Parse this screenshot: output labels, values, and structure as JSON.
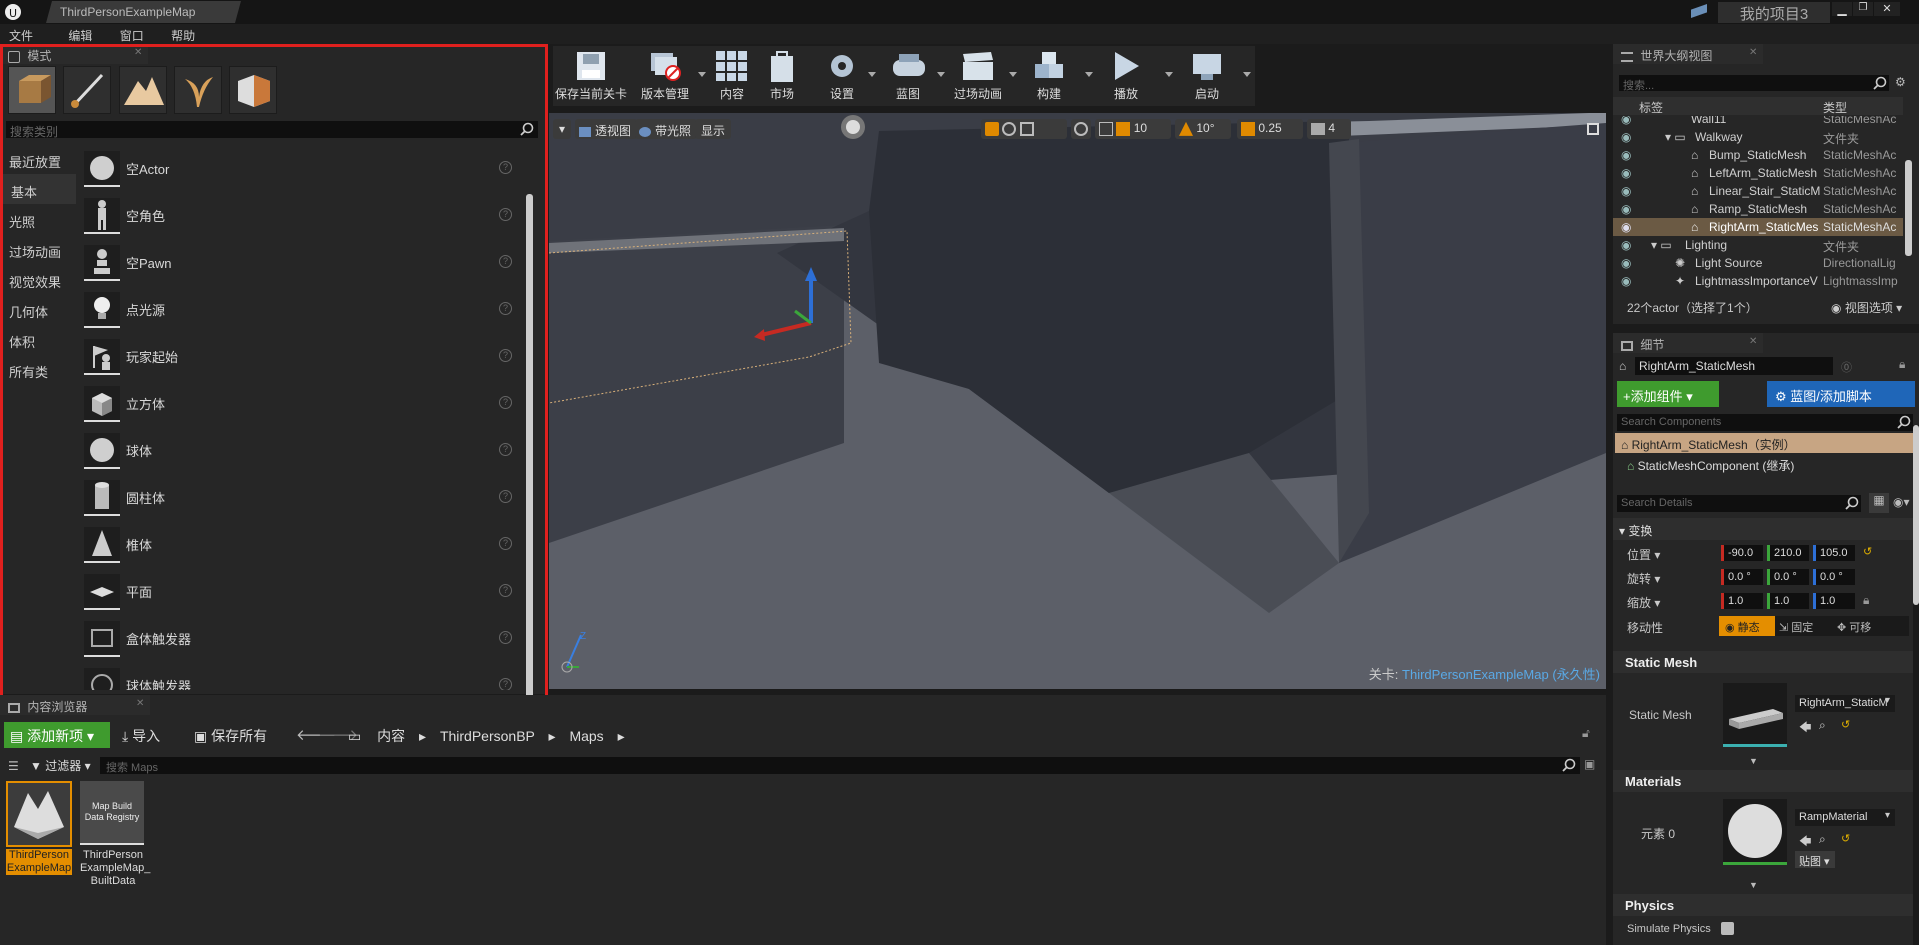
{
  "titlebar": {
    "tab": "ThirdPersonExampleMap",
    "project": "我的项目3"
  },
  "menu": [
    "文件",
    "编辑",
    "窗口",
    "帮助"
  ],
  "modes_panel": {
    "title": "模式",
    "search_placeholder": "搜索类别",
    "categories": [
      "最近放置",
      "基本",
      "光照",
      "过场动画",
      "视觉效果",
      "几何体",
      "体积",
      "所有类"
    ],
    "items": [
      "空Actor",
      "空角色",
      "空Pawn",
      "点光源",
      "玩家起始",
      "立方体",
      "球体",
      "圆柱体",
      "椎体",
      "平面",
      "盒体触发器",
      "球体触发器"
    ]
  },
  "toolbar": {
    "buttons": [
      "保存当前关卡",
      "版本管理",
      "内容",
      "市场",
      "设置",
      "蓝图",
      "过场动画",
      "构建",
      "播放",
      "启动"
    ]
  },
  "viewport": {
    "perspective": "透视图",
    "lit": "带光照",
    "show": "显示",
    "grid_snap": "10",
    "rot_snap": "10°",
    "scale_snap": "0.25",
    "cam_speed": "4",
    "level_label": "关卡:",
    "level_name": "ThirdPersonExampleMap (永久性)",
    "axis_z": "Z"
  },
  "outliner": {
    "title": "世界大纲视图",
    "search_placeholder": "搜索...",
    "col_label": "标签",
    "col_type": "类型",
    "rows": [
      {
        "label": "Wall11",
        "type": "StaticMeshAc"
      },
      {
        "label": "Walkway",
        "type": "文件夹"
      },
      {
        "label": "Bump_StaticMesh",
        "type": "StaticMeshAc"
      },
      {
        "label": "LeftArm_StaticMesh",
        "type": "StaticMeshAc"
      },
      {
        "label": "Linear_Stair_StaticM",
        "type": "StaticMeshAc"
      },
      {
        "label": "Ramp_StaticMesh",
        "type": "StaticMeshAc"
      },
      {
        "label": "RightArm_StaticMes",
        "type": "StaticMeshAc"
      },
      {
        "label": "Lighting",
        "type": "文件夹"
      },
      {
        "label": "Light Source",
        "type": "DirectionalLig"
      },
      {
        "label": "LightmassImportanceV",
        "type": "LightmassImp"
      }
    ],
    "status": "22个actor（选择了1个）",
    "view_options": "视图选项"
  },
  "details": {
    "title": "细节",
    "name_value": "RightArm_StaticMesh",
    "add_component": "+添加组件",
    "blueprint": "蓝图/添加脚本",
    "search_components": "Search Components",
    "instance_row": "RightArm_StaticMesh（实例）",
    "component_row": "StaticMeshComponent (继承)",
    "search_details": "Search Details",
    "transform": "变换",
    "location_label": "位置",
    "location": [
      "-90.0",
      "210.0",
      "105.0"
    ],
    "rotation_label": "旋转",
    "rotation": [
      "0.0 °",
      "0.0 °",
      "0.0 °"
    ],
    "scale_label": "缩放",
    "scale": [
      "1.0",
      "1.0",
      "1.0"
    ],
    "mobility_label": "移动性",
    "mobility": [
      "静态",
      "固定",
      "可移"
    ],
    "static_mesh_section": "Static Mesh",
    "static_mesh_label": "Static Mesh",
    "static_mesh_value": "RightArm_StaticM",
    "materials_section": "Materials",
    "element_label": "元素 0",
    "material_value": "RampMaterial",
    "texture_btn": "贴图",
    "physics_section": "Physics",
    "simulate_label": "Simulate Physics"
  },
  "content_browser": {
    "title": "内容浏览器",
    "add_new": "添加新项",
    "import": "导入",
    "save_all": "保存所有",
    "path": [
      "内容",
      "ThirdPersonBP",
      "Maps"
    ],
    "filter": "过滤器",
    "search_placeholder": "搜索 Maps",
    "assets": [
      {
        "name": "ThirdPerson ExampleMap"
      },
      {
        "name": "ThirdPerson ExampleMap_ BuiltData",
        "thumb": "Map Build Data Registry"
      }
    ]
  },
  "colors": {
    "accent": "#e48e00",
    "highlight_border": "#e0201e",
    "add_green": "#3f9b2e",
    "blueprint_blue": "#1f66b8"
  }
}
